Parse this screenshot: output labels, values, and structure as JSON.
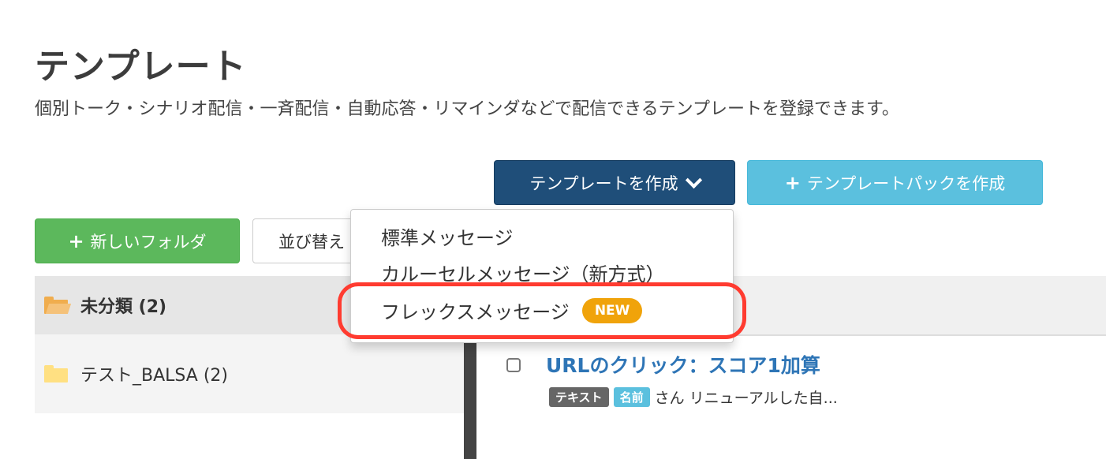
{
  "page": {
    "title": "テンプレート",
    "description": "個別トーク・シナリオ配信・一斉配信・自動応答・リマインダなどで配信できるテンプレートを登録できます。"
  },
  "toolbar": {
    "create_label": "テンプレートを作成",
    "pack_label": "テンプレートパックを作成",
    "new_folder_label": "新しいフォルダ",
    "sort_label": "並び替え"
  },
  "dropdown": {
    "items": [
      {
        "label": "標準メッセージ"
      },
      {
        "label": "カルーセルメッセージ（新方式）"
      },
      {
        "label": "フレックスメッセージ",
        "badge": "NEW"
      }
    ]
  },
  "sidebar": {
    "folders": [
      {
        "label": "未分類 (2)",
        "active": true
      },
      {
        "label": "テスト_BALSA (2)",
        "active": false
      }
    ]
  },
  "templates": [
    {
      "title": "URLのクリック：スコア1加算",
      "badges": [
        "テキスト",
        "名前"
      ],
      "preview": "さん リニューアルした自..."
    }
  ],
  "colors": {
    "primary_dark": "#1f4e79",
    "info": "#5bc0de",
    "success": "#5cb85c",
    "new_badge": "#f0a30a",
    "highlight": "#ff3b30",
    "link": "#2e75b6"
  }
}
